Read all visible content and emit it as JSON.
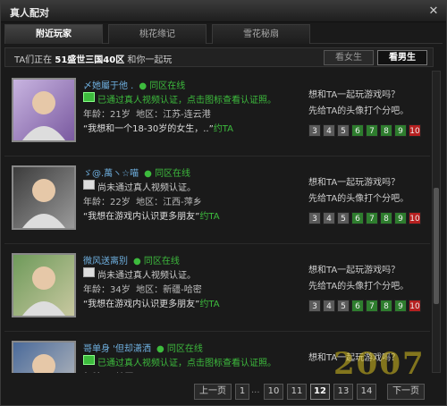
{
  "window": {
    "title": "真人配对",
    "close_label": "✕"
  },
  "tabs": [
    {
      "label": "附近玩家",
      "active": true
    },
    {
      "label": "桃花缘记",
      "active": false
    },
    {
      "label": "雪花秘扇",
      "active": false
    }
  ],
  "infobar": {
    "prefix": "TA们正在",
    "server": "51盛世三国40区",
    "suffix": "和你一起玩"
  },
  "gender": {
    "female_label": "看女生",
    "male_label": "看男生",
    "selected": "male"
  },
  "players": [
    {
      "name": "〆她屬于他 .",
      "online": "同区在线",
      "verify_text": "已通过真人视频认证，点击图标查看认证照。",
      "verified": true,
      "age_label": "年龄：",
      "age": "21岁",
      "region_label": "地区：",
      "region": "江苏-连云港",
      "quote": "“我想和一个18-30岁的女生，..”",
      "invite": "约TA",
      "ask1": "想和TA一起玩游戏吗？",
      "ask2": "先给TA的头像打个分吧。",
      "avatar_icon": "girl-photo"
    },
    {
      "name": "ゞ@.萬ヽ☆喵",
      "online": "同区在线",
      "verify_text": "尚未通过真人视频认证。",
      "verified": false,
      "age_label": "年龄：",
      "age": "22岁",
      "region_label": "地区：",
      "region": "江西-萍乡",
      "quote": "“我想在游戏内认识更多朋友”",
      "invite": "约TA",
      "ask1": "想和TA一起玩游戏吗？",
      "ask2": "先给TA的头像打个分吧。",
      "avatar_icon": "boy-sunglasses-photo"
    },
    {
      "name": "微风送离别",
      "online": "同区在线",
      "verify_text": "尚未通过真人视频认证。",
      "verified": false,
      "age_label": "年龄：",
      "age": "34岁",
      "region_label": "地区：",
      "region": "新疆-哈密",
      "quote": "“我想在游戏内认识更多朋友”",
      "invite": "约TA",
      "ask1": "想和TA一起玩游戏吗？",
      "ask2": "先给TA的头像打个分吧。",
      "avatar_icon": "man-outdoor-photo"
    },
    {
      "name": "哥单身 '但却潇洒",
      "online": "同区在线",
      "verify_text": "已通过真人视频认证，点击图标查看认证照。",
      "verified": true,
      "age_label": "年龄：",
      "age": "",
      "region_label": "地区：",
      "region": "",
      "quote": "",
      "invite": "",
      "ask1": "想和TA一起玩游戏吗？",
      "ask2": "",
      "avatar_icon": "person-photo"
    }
  ],
  "ratings": [
    "3",
    "4",
    "5",
    "6",
    "7",
    "8",
    "9",
    "10"
  ],
  "rating_colors": {
    "low": "#5a5a5a",
    "mid": "#2e7d2e",
    "high": "#b52020"
  },
  "pager": {
    "prev": "上一页",
    "pages": [
      "1",
      "10",
      "11",
      "12",
      "13",
      "14"
    ],
    "current": "12",
    "next": "下一页",
    "ellipsis": "..."
  },
  "watermark": "2007"
}
